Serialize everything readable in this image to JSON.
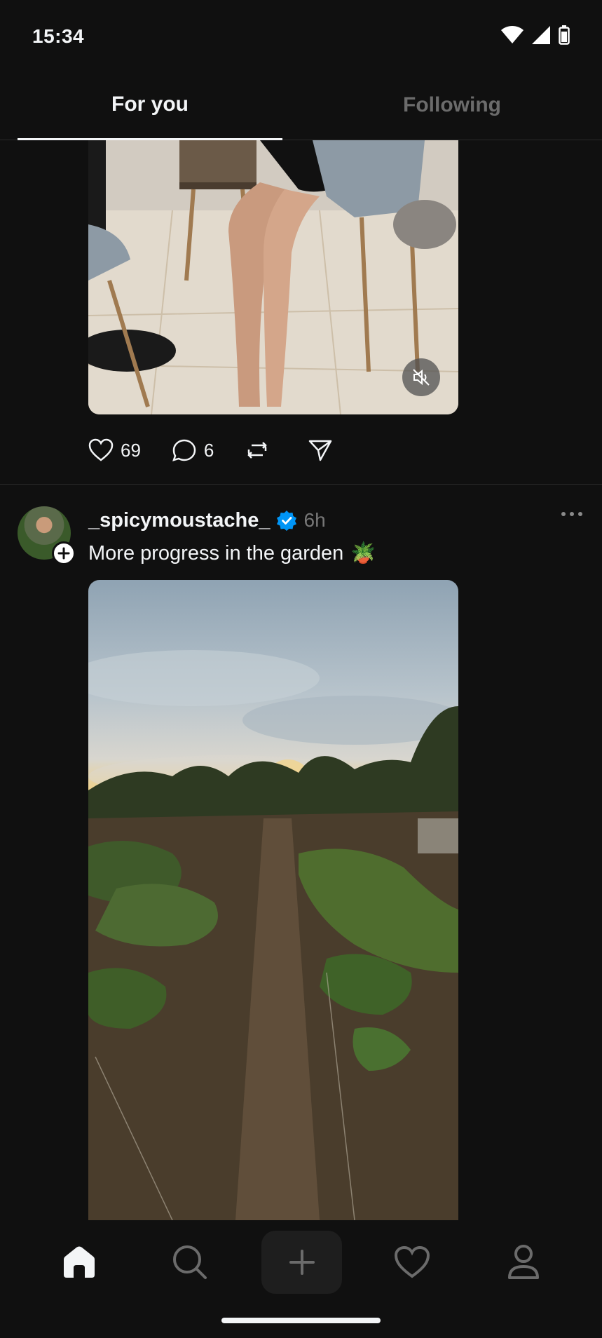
{
  "status_bar": {
    "time": "15:34"
  },
  "tabs": [
    {
      "label": "For you",
      "active": true
    },
    {
      "label": "Following",
      "active": false
    }
  ],
  "post1": {
    "likes": "69",
    "comments": "6"
  },
  "post2": {
    "username": "_spicymoustache_",
    "verified": true,
    "time_ago": "6h",
    "caption": "More progress in the garden",
    "caption_emoji": "🪴"
  },
  "bottom_nav": {
    "items": [
      "home",
      "search",
      "create",
      "activity",
      "profile"
    ],
    "active": "home"
  },
  "colors": {
    "background": "#101010",
    "text": "#f3f5f7",
    "muted": "#6b6b6b",
    "verified": "#0095f6"
  }
}
